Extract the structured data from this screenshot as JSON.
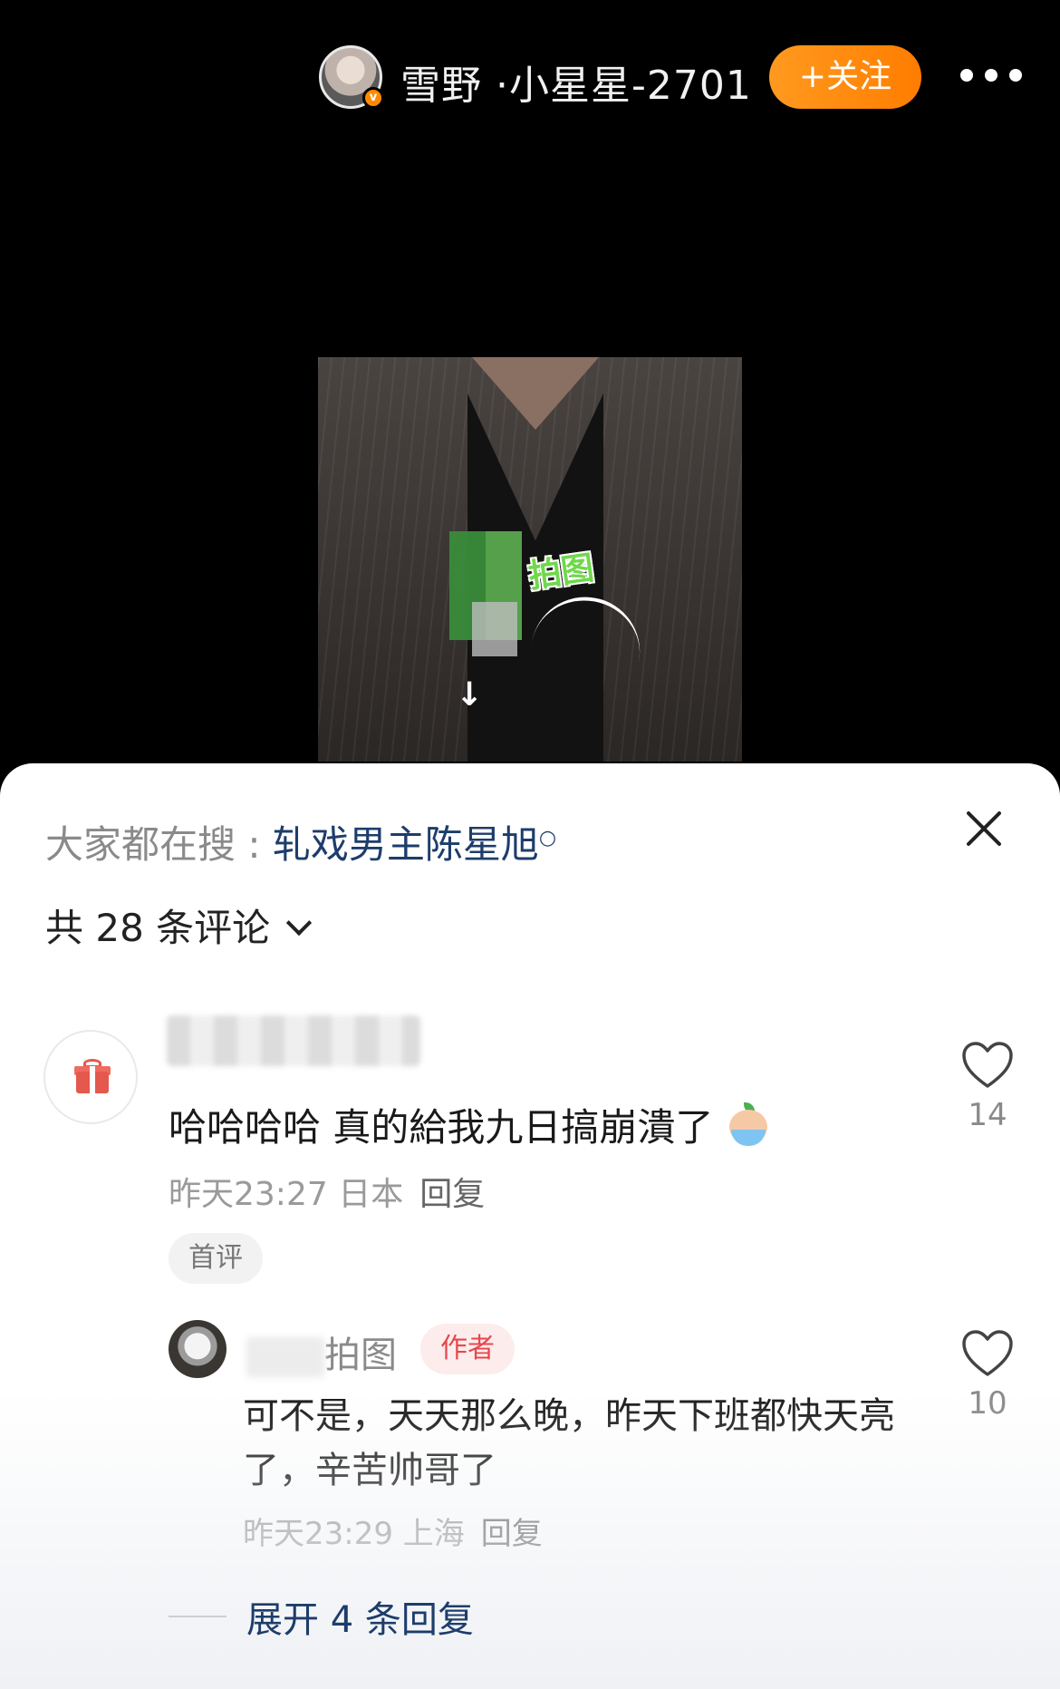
{
  "header": {
    "username": "雪野 ·小星星-2701",
    "follow_label": "+关注",
    "more_icon": "more-dots-icon"
  },
  "video": {
    "sticker_text": "拍图"
  },
  "sheet": {
    "hot_search_label": "大家都在搜 : ",
    "hot_search_term": "轧戏男主陈星旭",
    "comment_count_label": "共 28 条评论"
  },
  "comments": [
    {
      "text": "哈哈哈哈 真的給我九日搞崩潰了",
      "time": "昨天23:27 日本",
      "reply_label": "回复",
      "badge": "首评",
      "likes": "14",
      "avatar_icon": "gift-icon"
    }
  ],
  "replies": [
    {
      "name_suffix": "拍图",
      "badge": "作者",
      "text": "可不是，天天那么晚，昨天下班都快天亮了，辛苦帅哥了",
      "time": "昨天23:29 上海",
      "reply_label": "回复",
      "likes": "10"
    }
  ],
  "expand_replies_label": "展开 4 条回复",
  "colors": {
    "accent_orange": "#ff8a00",
    "link_blue": "#1d3d6b",
    "author_red": "#e5484d"
  }
}
